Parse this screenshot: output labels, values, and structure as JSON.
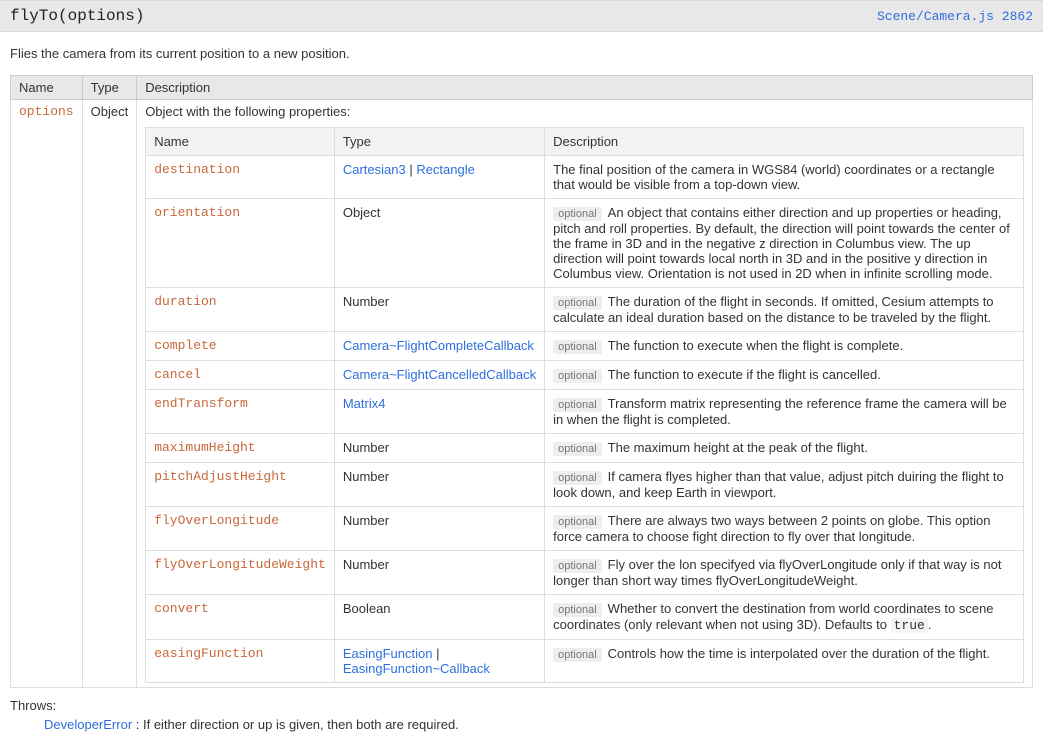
{
  "method": {
    "signature": "flyTo(options)",
    "source_link": "Scene/Camera.js 2862",
    "description": "Flies the camera from its current position to a new position."
  },
  "table": {
    "head_name": "Name",
    "head_type": "Type",
    "head_desc": "Description"
  },
  "options_row": {
    "name": "options",
    "type": "Object",
    "intro": "Object with the following properties:"
  },
  "inner_head": {
    "name": "Name",
    "type": "Type",
    "desc": "Description"
  },
  "optional_label": "optional",
  "props": {
    "destination": {
      "name": "destination",
      "type_a": "Cartesian3",
      "type_sep": " | ",
      "type_b": "Rectangle",
      "desc": "The final position of the camera in WGS84 (world) coordinates or a rectangle that would be visible from a top-down view."
    },
    "orientation": {
      "name": "orientation",
      "type": "Object",
      "desc": "An object that contains either direction and up properties or heading, pitch and roll properties. By default, the direction will point towards the center of the frame in 3D and in the negative z direction in Columbus view. The up direction will point towards local north in 3D and in the positive y direction in Columbus view. Orientation is not used in 2D when in infinite scrolling mode."
    },
    "duration": {
      "name": "duration",
      "type": "Number",
      "desc": "The duration of the flight in seconds. If omitted, Cesium attempts to calculate an ideal duration based on the distance to be traveled by the flight."
    },
    "complete": {
      "name": "complete",
      "type": "Camera~FlightCompleteCallback",
      "desc": "The function to execute when the flight is complete."
    },
    "cancel": {
      "name": "cancel",
      "type": "Camera~FlightCancelledCallback",
      "desc": "The function to execute if the flight is cancelled."
    },
    "endTransform": {
      "name": "endTransform",
      "type": "Matrix4",
      "desc": "Transform matrix representing the reference frame the camera will be in when the flight is completed."
    },
    "maximumHeight": {
      "name": "maximumHeight",
      "type": "Number",
      "desc": "The maximum height at the peak of the flight."
    },
    "pitchAdjustHeight": {
      "name": "pitchAdjustHeight",
      "type": "Number",
      "desc": "If camera flyes higher than that value, adjust pitch duiring the flight to look down, and keep Earth in viewport."
    },
    "flyOverLongitude": {
      "name": "flyOverLongitude",
      "type": "Number",
      "desc": "There are always two ways between 2 points on globe. This option force camera to choose fight direction to fly over that longitude."
    },
    "flyOverLongitudeWeight": {
      "name": "flyOverLongitudeWeight",
      "type": "Number",
      "desc": "Fly over the lon specifyed via flyOverLongitude only if that way is not longer than short way times flyOverLongitudeWeight."
    },
    "convert": {
      "name": "convert",
      "type": "Boolean",
      "desc_pre": "Whether to convert the destination from world coordinates to scene coordinates (only relevant when not using 3D). Defaults to ",
      "default_code": "true",
      "desc_post": "."
    },
    "easingFunction": {
      "name": "easingFunction",
      "type_a": "EasingFunction",
      "type_sep": " | ",
      "type_b": "EasingFunction~Callback",
      "desc": "Controls how the time is interpolated over the duration of the flight."
    }
  },
  "throws": {
    "label": "Throws:",
    "error_type": "DeveloperError",
    "text": " : If either direction or up is given, then both are required."
  }
}
